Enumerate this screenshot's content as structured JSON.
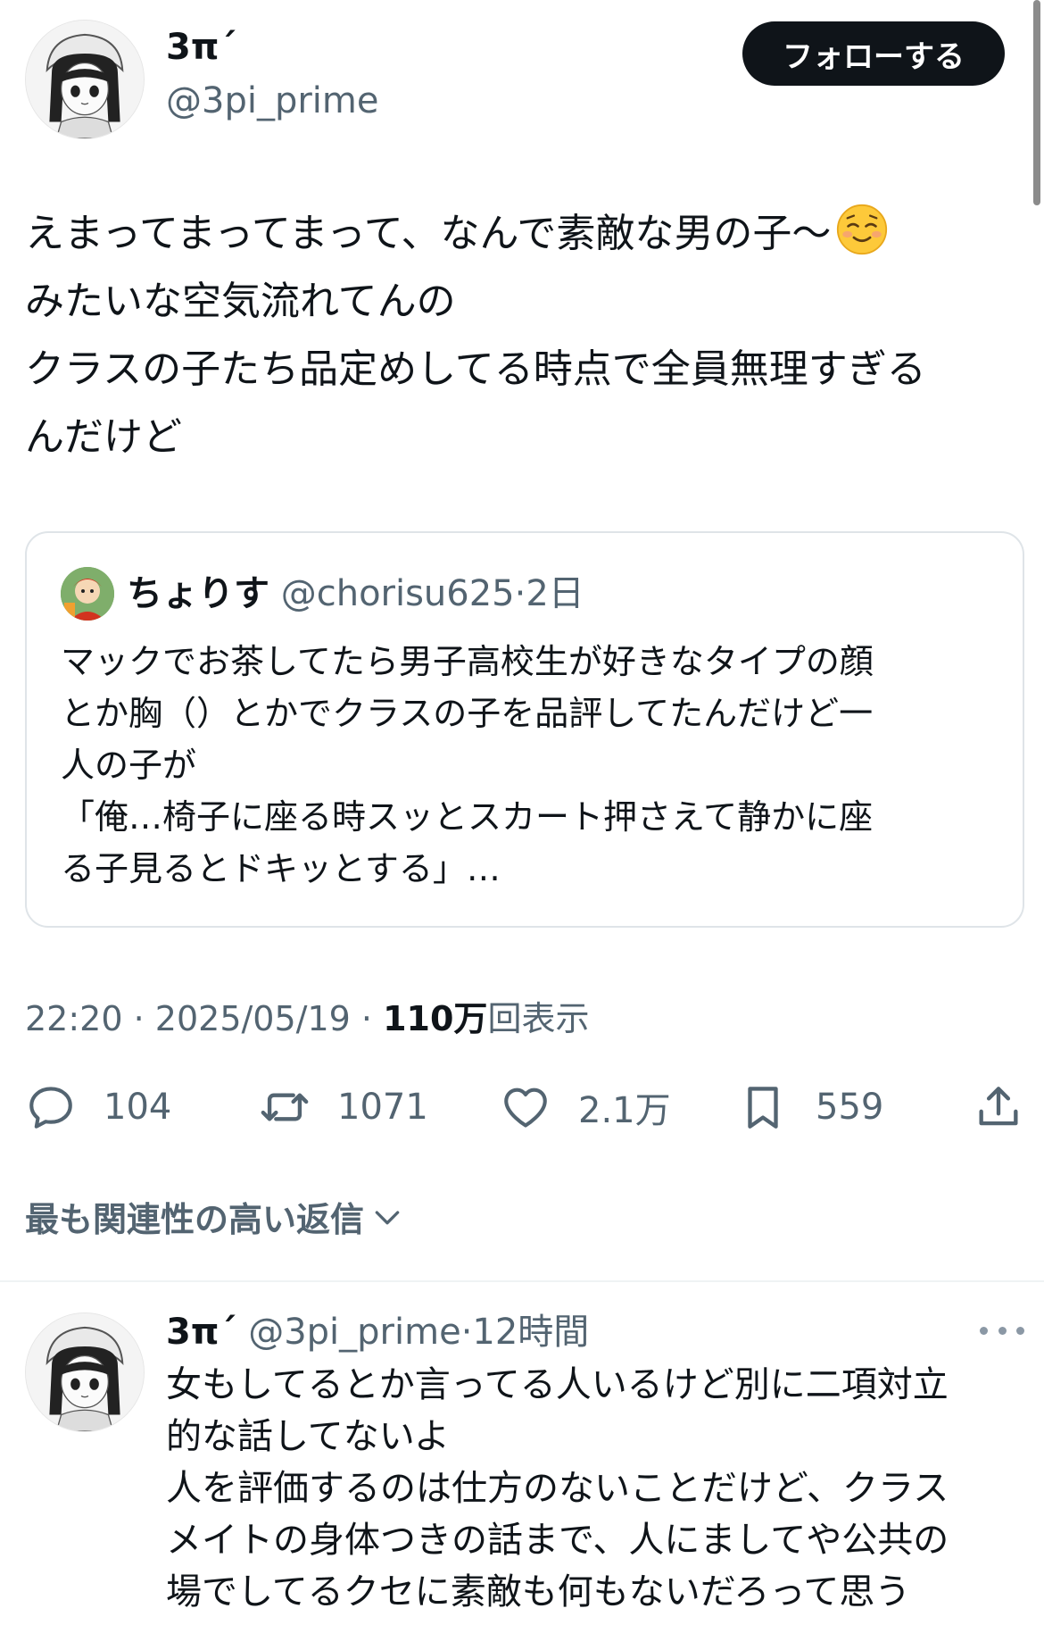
{
  "author": {
    "name": "3π´",
    "handle": "@3pi_prime"
  },
  "follow_label": "フォローする",
  "tweet": {
    "lines": [
      "えまってまってまって、なんで素敵な男の子〜",
      "みたいな空気流れてんの",
      "クラスの子たち品定めしてる時点で全員無理すぎる",
      "んだけど"
    ]
  },
  "quote": {
    "name": "ちょりす",
    "handle": "@chorisu625",
    "separator": "·",
    "time": "2日",
    "lines": [
      "マックでお茶してたら男子高校生が好きなタイプの顔",
      "とか胸（）とかでクラスの子を品評してたんだけど一",
      "人の子が",
      "「俺…椅子に座る時スッとスカート押さえて静かに座",
      "る子見るとドキッとする」…"
    ]
  },
  "meta": {
    "time": "22:20",
    "separator": "·",
    "date": "2025/05/19",
    "views_count": "110万",
    "views_label": "回表示"
  },
  "actions": {
    "replies": "104",
    "reposts": "1071",
    "likes": "2.1万",
    "bookmarks": "559"
  },
  "sort_label": "最も関連性の高い返信",
  "reply": {
    "name": "3π´",
    "handle": "@3pi_prime",
    "separator": "·",
    "time": "12時間",
    "lines": [
      "女もしてるとか言ってる人いるけど別に二項対立",
      "的な話してないよ",
      "人を評価するのは仕方のないことだけど、クラス",
      "メイトの身体つきの話まで、人にましてや公共の",
      "場でしてるクセに素敵も何もないだろって思う"
    ]
  },
  "icons": {
    "emoji": "smiling-face-icon",
    "reply": "comment-bubble-icon",
    "repost": "repost-icon",
    "like": "heart-icon",
    "bookmark": "bookmark-icon",
    "share": "share-icon",
    "sort": "chevron-down-icon",
    "more": "more-dots-icon"
  },
  "colors": {
    "text": "#0f1419",
    "secondary": "#536471",
    "border": "#dfe4e8",
    "follow_bg": "#0f1419"
  }
}
